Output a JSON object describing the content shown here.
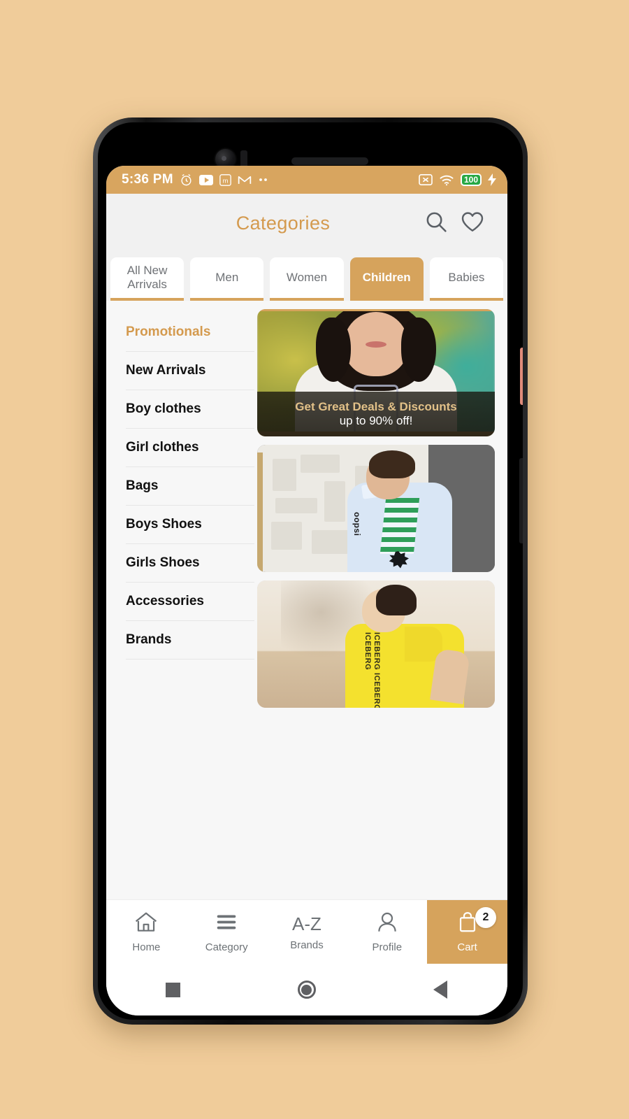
{
  "theme": {
    "page_bg": "#F0CC9A",
    "accent": "#D6A35C",
    "accent_text": "#D49A4E",
    "status_bar_bg": "#D8A55F",
    "screen_bg": "#f7f7f7"
  },
  "status_bar": {
    "time": "5:36 PM",
    "left_icons": [
      "alarm-clock-icon",
      "youtube-icon",
      "m-app-icon",
      "gmail-icon",
      "more-notifications-icon"
    ],
    "right_icons": [
      "sim-disabled-icon",
      "wifi-icon",
      "battery-icon",
      "charging-bolt-icon"
    ],
    "battery_level": "100"
  },
  "header": {
    "title": "Categories",
    "search_icon": "search-icon",
    "wishlist_icon": "heart-icon"
  },
  "tabs": [
    {
      "label": "All New Arrivals",
      "active": false
    },
    {
      "label": "Men",
      "active": false
    },
    {
      "label": "Women",
      "active": false
    },
    {
      "label": "Children",
      "active": true
    },
    {
      "label": "Babies",
      "active": false
    }
  ],
  "category_list": [
    {
      "label": "Promotionals",
      "selected": true
    },
    {
      "label": "New Arrivals",
      "selected": false
    },
    {
      "label": "Boy clothes",
      "selected": false
    },
    {
      "label": "Girl clothes",
      "selected": false
    },
    {
      "label": "Bags",
      "selected": false
    },
    {
      "label": "Boys Shoes",
      "selected": false
    },
    {
      "label": "Girls Shoes",
      "selected": false
    },
    {
      "label": "Accessories",
      "selected": false
    },
    {
      "label": "Brands",
      "selected": false
    }
  ],
  "banners": [
    {
      "name": "promo-banner-deals",
      "overlay_line1": "Get Great Deals & Discounts",
      "overlay_line2": "up to 90% off!",
      "alt": "girl in white printed t-shirt outdoors"
    },
    {
      "name": "promo-banner-boy-shirt",
      "alt": "boy in light blue shirt with green stripes",
      "shirt_text": "oopsi"
    },
    {
      "name": "promo-banner-yellow-tee",
      "alt": "boy in yellow Iceberg t-shirt",
      "shirt_text": "ICEBERG ICEBERG ICEBERG"
    }
  ],
  "bottom_nav": [
    {
      "label": "Home",
      "icon": "home-icon",
      "active": false,
      "badge": ""
    },
    {
      "label": "Category",
      "icon": "menu-icon",
      "active": false,
      "badge": ""
    },
    {
      "label": "Brands",
      "icon": "a-z-icon",
      "active": false,
      "badge": ""
    },
    {
      "label": "Profile",
      "icon": "person-icon",
      "active": false,
      "badge": ""
    },
    {
      "label": "Cart",
      "icon": "shopping-bag-icon",
      "active": true,
      "badge": "2"
    }
  ],
  "android_nav": [
    {
      "name": "recents-button",
      "icon": "square-icon"
    },
    {
      "name": "home-button",
      "icon": "circle-icon"
    },
    {
      "name": "back-button",
      "icon": "triangle-icon"
    }
  ],
  "brands_icon_text": "A-Z"
}
